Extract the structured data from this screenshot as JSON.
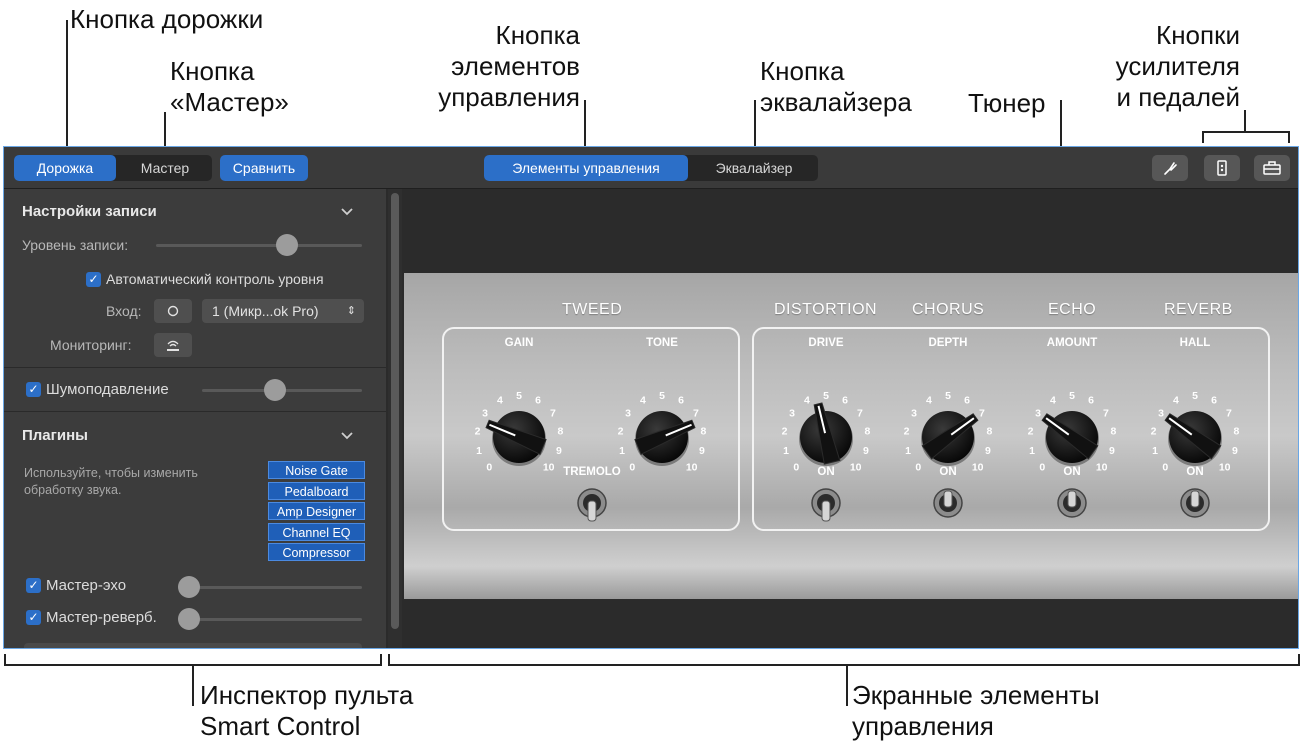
{
  "callouts": {
    "track_button": "Кнопка дорожки",
    "master_button": "Кнопка\n«Мастер»",
    "controls_button": "Кнопка\nэлементов\nуправления",
    "eq_button": "Кнопка\nэквалайзера",
    "tuner": "Тюнер",
    "amp_pedal_buttons": "Кнопки\nусилителя\nи педалей",
    "inspector": "Инспектор пульта\nSmart Control",
    "screen_controls": "Экранные элементы\nуправления"
  },
  "toolbar": {
    "track_label": "Дорожка",
    "master_label": "Мастер",
    "compare_label": "Сравнить",
    "controls_label": "Элементы управления",
    "eq_label": "Эквалайзер",
    "icons": [
      "tuning-fork-icon",
      "amp-icon",
      "pedalboard-icon"
    ]
  },
  "inspector": {
    "record_settings": "Настройки записи",
    "record_level": "Уровень записи:",
    "record_level_value": 0.65,
    "auto_level": "Автоматический контроль уровня",
    "input_label": "Вход:",
    "input_value": "1 (Микр...ok Pro)",
    "monitoring_label": "Мониторинг:",
    "noise_gate": "Шумоподавление",
    "noise_gate_value": 0.45,
    "plugins_title": "Плагины",
    "plugins_hint": "Используйте, чтобы изменить обработку звука.",
    "plugins": [
      "Noise Gate",
      "Pedalboard",
      "Amp Designer",
      "Channel EQ",
      "Compressor"
    ],
    "master_echo": "Мастер-эхо",
    "master_echo_value": 0.0,
    "master_reverb": "Мастер-реверб.",
    "master_reverb_value": 0.0
  },
  "amp": {
    "sections": {
      "tweed": "TWEED",
      "distortion": "DISTORTION",
      "chorus": "CHORUS",
      "echo": "ECHO",
      "reverb": "REVERB"
    },
    "knobs": [
      {
        "label": "GAIN",
        "value": 2.5
      },
      {
        "label": "TONE",
        "value": 7.5
      },
      {
        "label": "DRIVE",
        "value": 4.5
      },
      {
        "label": "DEPTH",
        "value": 7
      },
      {
        "label": "AMOUNT",
        "value": 3
      },
      {
        "label": "HALL",
        "value": 3
      }
    ],
    "scale": [
      "0",
      "1",
      "2",
      "3",
      "4",
      "5",
      "6",
      "7",
      "8",
      "9",
      "10"
    ],
    "switches": [
      {
        "label": "TREMOLO",
        "state": "off"
      },
      {
        "label": "ON",
        "state": "off"
      },
      {
        "label": "ON",
        "state": "on"
      },
      {
        "label": "ON",
        "state": "on"
      },
      {
        "label": "ON",
        "state": "on"
      }
    ]
  }
}
